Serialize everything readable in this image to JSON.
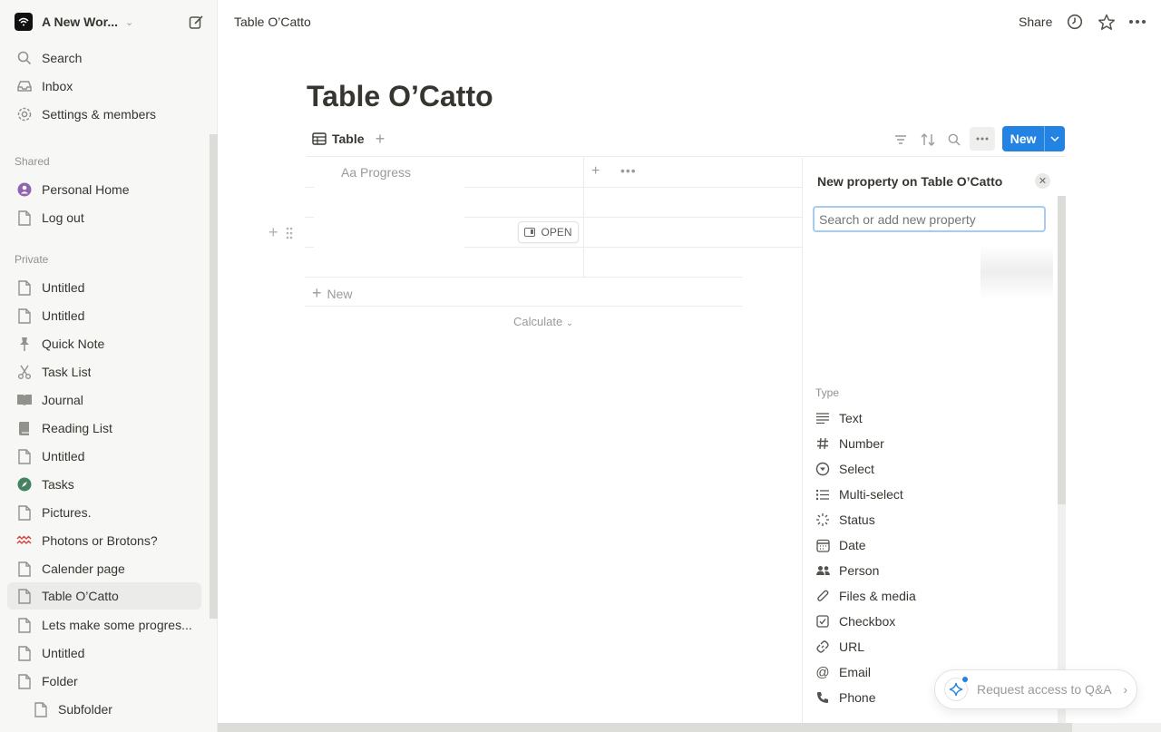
{
  "workspace": {
    "name": "A New Wor...",
    "logo": "wifi-logo"
  },
  "sidebar": {
    "top_items": [
      {
        "label": "Search",
        "icon": "search-icon"
      },
      {
        "label": "Inbox",
        "icon": "inbox-icon"
      },
      {
        "label": "Settings & members",
        "icon": "gear-icon"
      }
    ],
    "shared_label": "Shared",
    "shared_items": [
      {
        "label": "Personal Home",
        "icon": "user-circle-icon"
      },
      {
        "label": "Log out",
        "icon": "page-icon"
      }
    ],
    "private_label": "Private",
    "private_items": [
      {
        "label": "Untitled",
        "icon": "page-icon"
      },
      {
        "label": "Untitled",
        "icon": "page-icon"
      },
      {
        "label": "Quick Note",
        "icon": "pin-icon"
      },
      {
        "label": "Task List",
        "icon": "scissors-icon"
      },
      {
        "label": "Journal",
        "icon": "book-icon"
      },
      {
        "label": "Reading List",
        "icon": "bookmark-book-icon"
      },
      {
        "label": "Untitled",
        "icon": "page-icon"
      },
      {
        "label": "Tasks",
        "icon": "compass-icon"
      },
      {
        "label": "Pictures.",
        "icon": "page-icon"
      },
      {
        "label": "Photons or Brotons?",
        "icon": "wave-icon"
      },
      {
        "label": "Calender page",
        "icon": "page-icon"
      },
      {
        "label": "Table O’Catto",
        "icon": "page-icon"
      },
      {
        "label": "Lets make some progres...",
        "icon": "page-icon"
      },
      {
        "label": "Untitled",
        "icon": "page-icon"
      },
      {
        "label": "Folder",
        "icon": "page-icon"
      },
      {
        "label": "Subfolder",
        "icon": "page-icon"
      }
    ]
  },
  "topbar": {
    "breadcrumb": "Table O’Catto",
    "share": "Share"
  },
  "page": {
    "title": "Table O’Catto",
    "view_tab": "Table",
    "new_button": "New",
    "column_header": "Aa Progress",
    "open_button": "OPEN",
    "new_row": "New",
    "calculate": "Calculate"
  },
  "panel": {
    "title": "New property on Table O’Catto",
    "search_placeholder": "Search or add new property",
    "type_label": "Type",
    "types": [
      {
        "label": "Text",
        "icon": "text-lines-icon"
      },
      {
        "label": "Number",
        "icon": "hash-icon"
      },
      {
        "label": "Select",
        "icon": "select-circle-icon"
      },
      {
        "label": "Multi-select",
        "icon": "list-icon"
      },
      {
        "label": "Status",
        "icon": "status-spinner-icon"
      },
      {
        "label": "Date",
        "icon": "calendar-icon"
      },
      {
        "label": "Person",
        "icon": "people-icon"
      },
      {
        "label": "Files & media",
        "icon": "paperclip-icon"
      },
      {
        "label": "Checkbox",
        "icon": "checkbox-icon"
      },
      {
        "label": "URL",
        "icon": "link-icon"
      },
      {
        "label": "Email",
        "icon": "at-icon"
      },
      {
        "label": "Phone",
        "icon": "phone-icon"
      }
    ]
  },
  "qa_button": {
    "label": "Request access to Q&A"
  },
  "colors": {
    "accent": "#2383e2",
    "sidebar_bg": "#f7f7f5",
    "text": "#37352f",
    "muted": "#9b9a97"
  }
}
